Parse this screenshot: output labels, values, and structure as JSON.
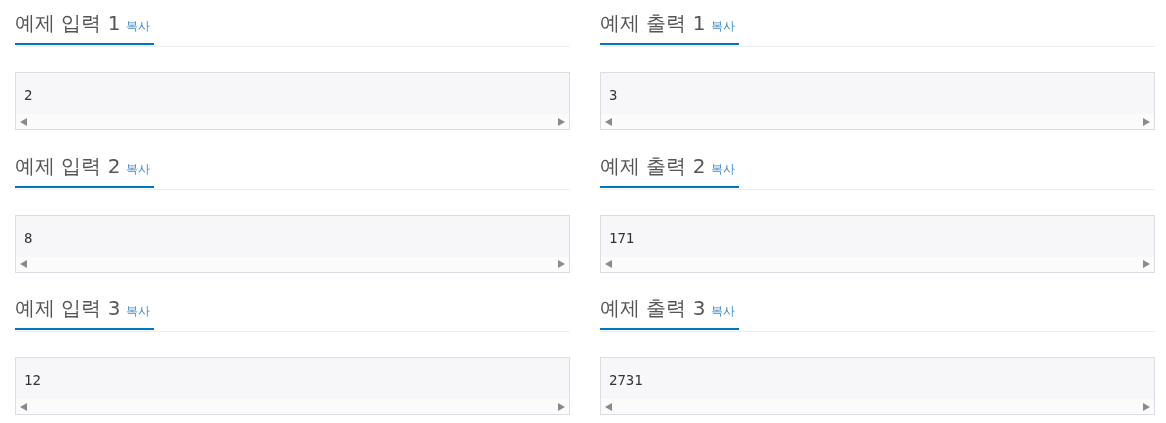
{
  "rows": [
    {
      "input": {
        "title": "예제 입력 1",
        "copy": "복사",
        "value": "2"
      },
      "output": {
        "title": "예제 출력 1",
        "copy": "복사",
        "value": "3"
      }
    },
    {
      "input": {
        "title": "예제 입력 2",
        "copy": "복사",
        "value": "8"
      },
      "output": {
        "title": "예제 출력 2",
        "copy": "복사",
        "value": "171"
      }
    },
    {
      "input": {
        "title": "예제 입력 3",
        "copy": "복사",
        "value": "12"
      },
      "output": {
        "title": "예제 출력 3",
        "copy": "복사",
        "value": "2731"
      }
    }
  ]
}
